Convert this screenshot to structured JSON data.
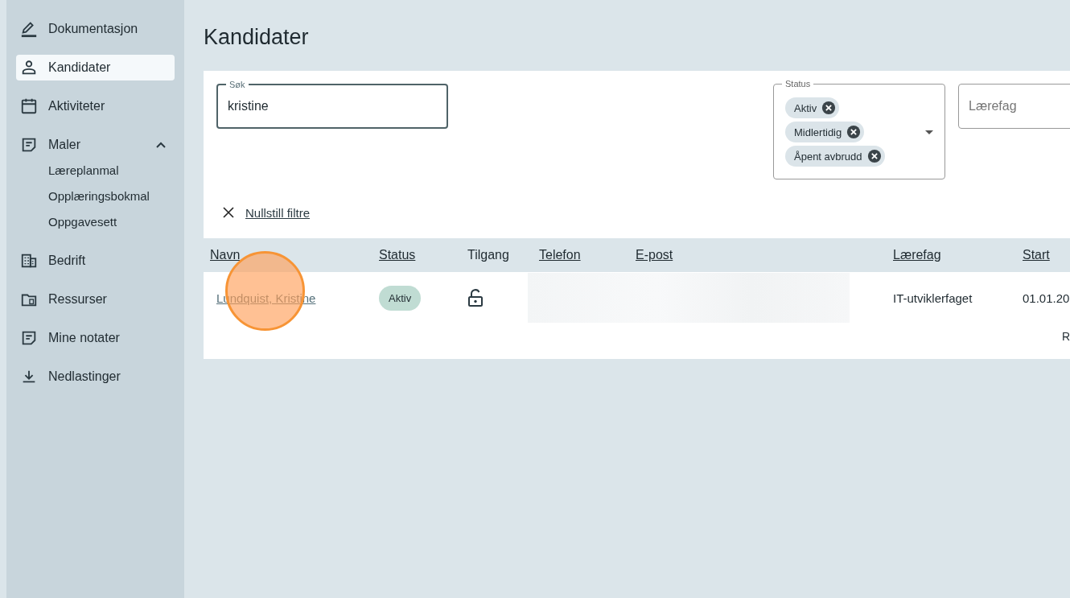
{
  "sidebar": {
    "items": [
      {
        "label": "Dokumentasjon",
        "selected": false
      },
      {
        "label": "Kandidater",
        "selected": true
      },
      {
        "label": "Aktiviteter",
        "selected": false
      },
      {
        "label": "Maler",
        "selected": false,
        "expanded": true,
        "children": [
          {
            "label": "Læreplanmal",
            "selected": false
          },
          {
            "label": "Opplæringsbokmal",
            "selected": false
          },
          {
            "label": "Oppgavesett",
            "selected": false
          }
        ]
      },
      {
        "label": "Bedrift",
        "selected": false
      },
      {
        "label": "Ressurser",
        "selected": false
      },
      {
        "label": "Mine notater",
        "selected": false
      },
      {
        "label": "Nedlastinger",
        "selected": false
      }
    ]
  },
  "page_title": "Kandidater",
  "filters": {
    "search": {
      "label": "Søk",
      "value": "kristine"
    },
    "status": {
      "label": "Status",
      "chips": [
        {
          "label": "Aktiv"
        },
        {
          "label": "Midlertidig"
        },
        {
          "label": "Åpent avbrudd"
        }
      ]
    },
    "subject": {
      "placeholder": "Lærefag"
    },
    "reset": "Nullstill filtre"
  },
  "table": {
    "columns": [
      {
        "label": "Navn",
        "sortable": true
      },
      {
        "label": "Status",
        "sortable": true
      },
      {
        "label": "Tilgang",
        "sortable": false
      },
      {
        "label": "Telefon",
        "sortable": true
      },
      {
        "label": "E-post",
        "sortable": true
      },
      {
        "label": "Lærefag",
        "sortable": true
      },
      {
        "label": "Start",
        "sortable": true
      }
    ],
    "rows": [
      {
        "name": "Lundquist, Kristine",
        "status": "Aktiv",
        "locked": false,
        "contact_redacted": true,
        "subject": "IT-utviklerfaget",
        "start": "01.01.20",
        "click_marker": true
      }
    ],
    "footer": "R"
  }
}
